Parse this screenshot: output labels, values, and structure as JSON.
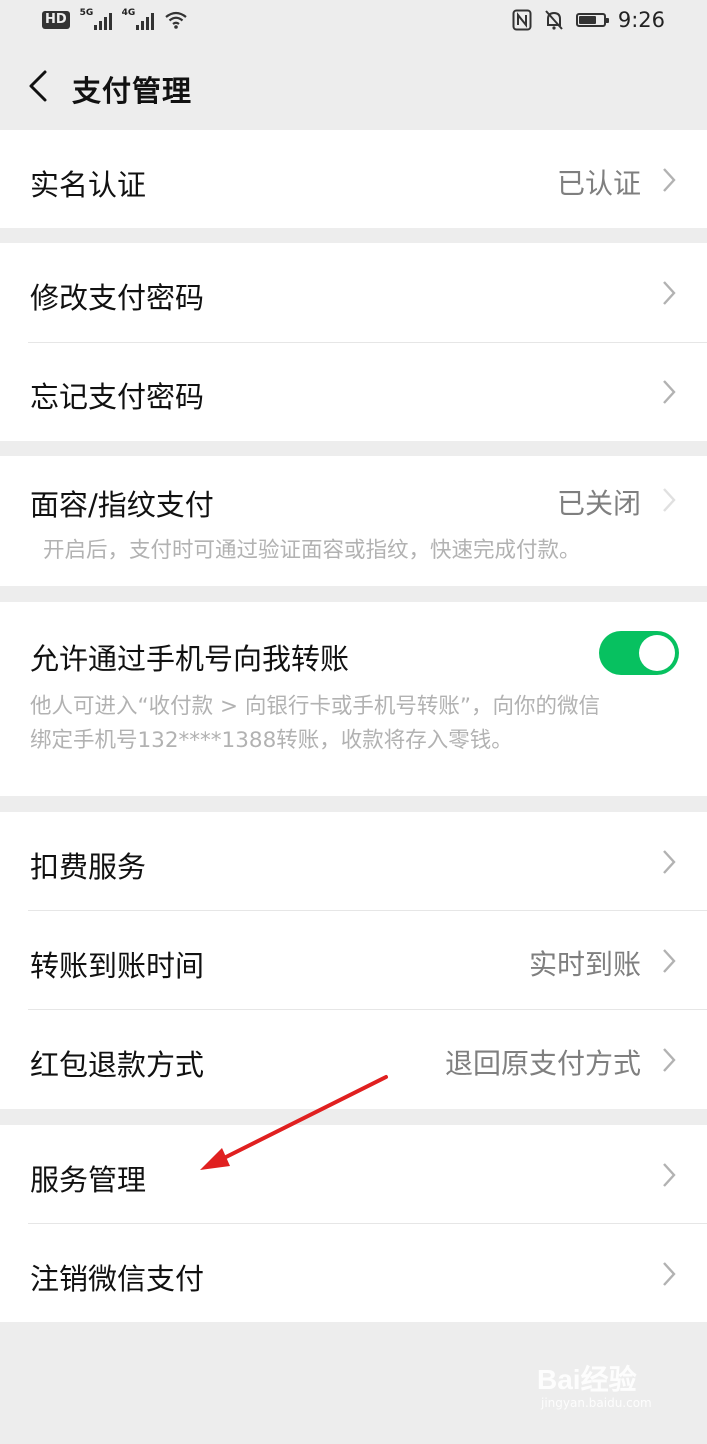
{
  "status_bar": {
    "hd": "HD",
    "sim1_net": "5G",
    "sim2_net": "4G",
    "battery_level": 0.7,
    "time": "9:26"
  },
  "header": {
    "title": "支付管理"
  },
  "rows": {
    "real_name": {
      "label": "实名认证",
      "value": "已认证"
    },
    "change_password": {
      "label": "修改支付密码"
    },
    "forgot_password": {
      "label": "忘记支付密码"
    },
    "face_fingerprint": {
      "label": "面容/指纹支付",
      "value": "已关闭",
      "description": "开启后，支付时可通过验证面容或指纹，快速完成付款。"
    },
    "phone_transfer": {
      "label": "允许通过手机号向我转账",
      "enabled": true,
      "description_line1": "他人可进入“收付款 > 向银行卡或手机号转账”，向你的微信",
      "description_line2": "绑定手机号132****1388转账，收款将存入零钱。"
    },
    "deduction_service": {
      "label": "扣费服务"
    },
    "transfer_time": {
      "label": "转账到账时间",
      "value": "实时到账"
    },
    "red_packet_refund": {
      "label": "红包退款方式",
      "value": "退回原支付方式"
    },
    "service_management": {
      "label": "服务管理"
    },
    "cancel_wechat_pay": {
      "label": "注销微信支付"
    }
  },
  "annotation": {
    "arrow_color": "#e02020"
  },
  "colors": {
    "accent_green": "#07c160",
    "background": "#ededed"
  },
  "watermark": {
    "text": "Bai经验",
    "sub": "jingyan.baidu.com"
  }
}
